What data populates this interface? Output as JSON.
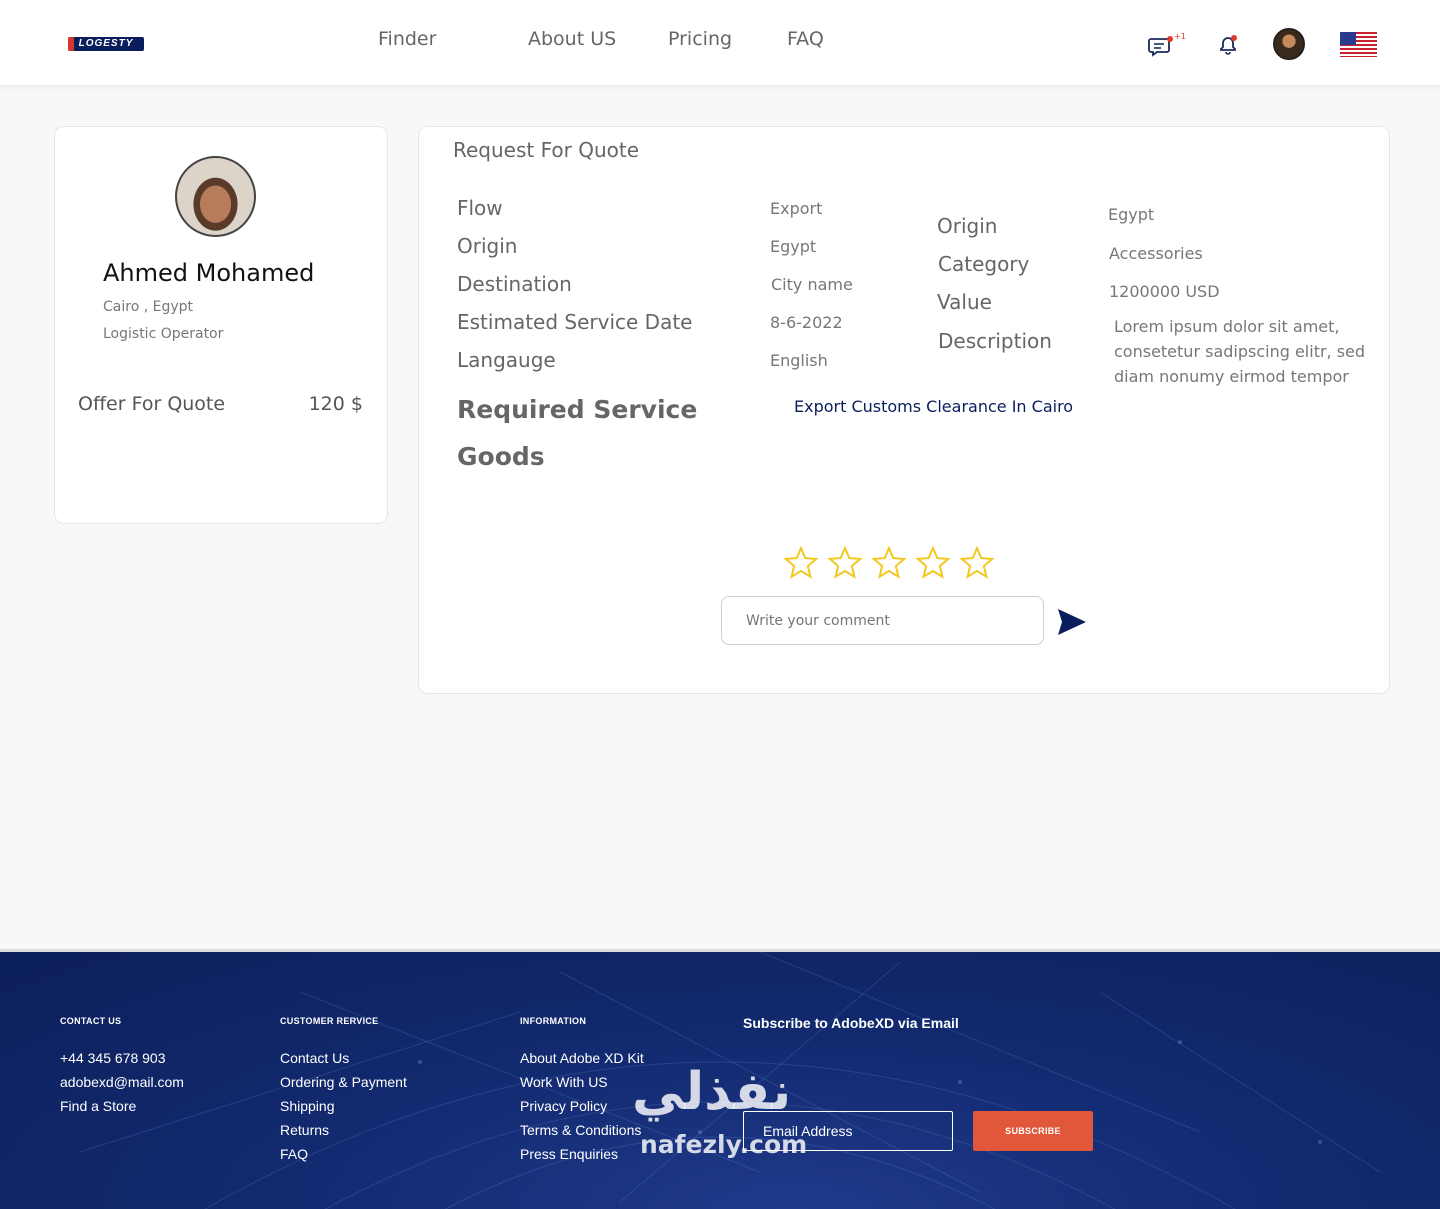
{
  "header": {
    "logo_text": "LOGESTY",
    "nav": [
      "Finder",
      "About US",
      "Pricing",
      "FAQ"
    ],
    "message_badge": "+1"
  },
  "profile": {
    "name": "Ahmed Mohamed",
    "location": "Cairo , Egypt",
    "role": "Logistic Operator",
    "offer_label": "Offer For Quote",
    "offer_value": "120 $"
  },
  "quote": {
    "title": "Request For Quote",
    "left_fields": [
      {
        "label": "Flow",
        "value": "Export"
      },
      {
        "label": "Origin",
        "value": "Egypt"
      },
      {
        "label": "Destination",
        "value": "City name"
      },
      {
        "label": "Estimated Service Date",
        "value": "8-6-2022"
      },
      {
        "label": "Langauge",
        "value": "English"
      }
    ],
    "right_fields": [
      {
        "label": "Origin",
        "value": "Egypt"
      },
      {
        "label": "Category",
        "value": "Accessories"
      },
      {
        "label": "Value",
        "value": "1200000  USD"
      },
      {
        "label": "Description",
        "value": "Lorem ipsum dolor sit amet, consetetur sadipscing elitr, sed diam nonumy eirmod tempor"
      }
    ],
    "required_service_label": "Required Service",
    "required_service_value": "Export Customs Clearance In Cairo",
    "goods_label": "Goods",
    "rating": 0,
    "rating_max": 5,
    "comment_placeholder": "Write your comment"
  },
  "colors": {
    "star": "#f2c81e",
    "brand_navy": "#0a1d5c",
    "subscribe": "#e0573a"
  },
  "footer": {
    "contact": {
      "heading": "CONTACT US",
      "items": [
        "+44 345 678 903",
        "adobexd@mail.com",
        "Find a Store"
      ]
    },
    "customer": {
      "heading": "CUSTOMER RERVICE",
      "items": [
        "Contact Us",
        "Ordering & Payment",
        "Shipping",
        "Returns",
        "FAQ"
      ]
    },
    "information": {
      "heading": "INFORMATION",
      "items": [
        "About Adobe XD Kit",
        "Work With US",
        "Privacy Policy",
        "Terms & Conditions",
        "Press Enquiries"
      ]
    },
    "subscribe_title": "Subscribe to AdobeXD via Email",
    "email_placeholder": "Email Address",
    "subscribe_button": "SUBSCRIBE"
  },
  "watermark": {
    "arabic": "نفذلي",
    "latin": "nafezly.com"
  }
}
